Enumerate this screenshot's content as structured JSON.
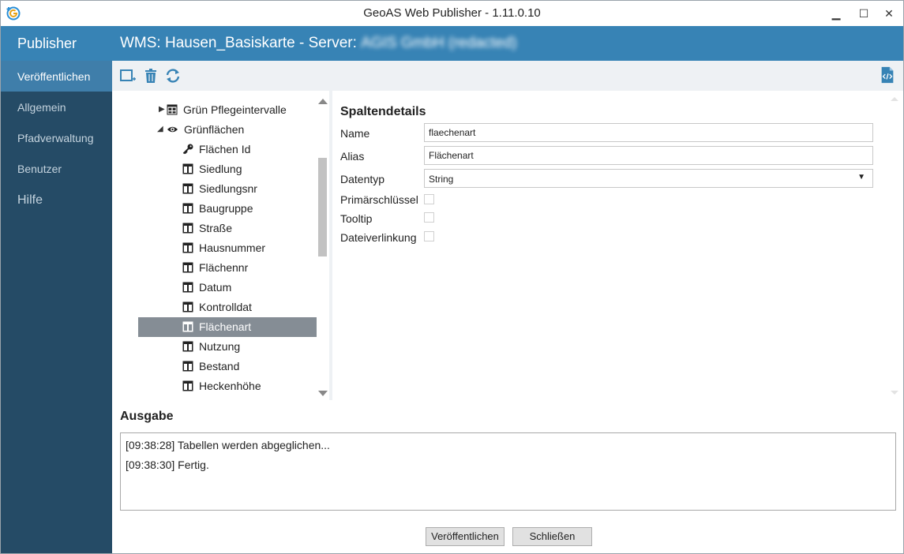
{
  "window": {
    "title": "GeoAS Web Publisher - 1.11.0.10",
    "controls": {
      "minimize": "▁",
      "maximize": "☐",
      "close": "✕"
    }
  },
  "sidebar": {
    "header": "Publisher",
    "items": [
      {
        "label": "Veröffentlichen",
        "active": true
      },
      {
        "label": "Allgemein"
      },
      {
        "label": "Pfadverwaltung"
      },
      {
        "label": "Benutzer"
      },
      {
        "label": "Hilfe"
      }
    ]
  },
  "header": {
    "title_prefix": "WMS: Hausen_Basiskarte - Server: ",
    "server_redacted": "AGIS GmbH (redacted)"
  },
  "toolbar": {
    "icons": [
      "add-layer-icon",
      "trash-icon",
      "refresh-icon",
      "code-file-icon"
    ]
  },
  "tree": {
    "items": [
      {
        "label": "Grün Pflegeintervalle",
        "icon": "table-icon",
        "expander": "▶"
      },
      {
        "label": "Grünflächen",
        "icon": "eye-icon",
        "expander": "◢"
      },
      {
        "label": "Flächen Id",
        "icon": "key-icon"
      },
      {
        "label": "Siedlung",
        "icon": "column-icon"
      },
      {
        "label": "Siedlungsnr",
        "icon": "column-icon"
      },
      {
        "label": "Baugruppe",
        "icon": "column-icon"
      },
      {
        "label": "Straße",
        "icon": "column-icon"
      },
      {
        "label": "Hausnummer",
        "icon": "column-icon"
      },
      {
        "label": "Flächennr",
        "icon": "column-icon"
      },
      {
        "label": "Datum",
        "icon": "column-icon"
      },
      {
        "label": "Kontrolldat",
        "icon": "column-icon"
      },
      {
        "label": "Flächenart",
        "icon": "column-icon",
        "selected": true
      },
      {
        "label": "Nutzung",
        "icon": "column-icon"
      },
      {
        "label": "Bestand",
        "icon": "column-icon"
      },
      {
        "label": "Heckenhöhe",
        "icon": "column-icon"
      }
    ]
  },
  "details": {
    "title": "Spaltendetails",
    "name_label": "Name",
    "name_value": "flaechenart",
    "alias_label": "Alias",
    "alias_value": "Flächenart",
    "datatype_label": "Datentyp",
    "datatype_value": "String",
    "primary_key_label": "Primärschlüssel",
    "primary_key_checked": false,
    "tooltip_label": "Tooltip",
    "tooltip_checked": false,
    "file_link_label": "Dateiverlinkung",
    "file_link_checked": false
  },
  "output": {
    "title": "Ausgabe",
    "lines": [
      "[09:38:28] Tabellen werden abgeglichen...",
      "[09:38:30] Fertig."
    ]
  },
  "buttons": {
    "publish": "Veröffentlichen",
    "close": "Schließen"
  },
  "colors": {
    "sidebar": "#254b66",
    "accent": "#3783b5",
    "selected_row": "#858d95"
  }
}
